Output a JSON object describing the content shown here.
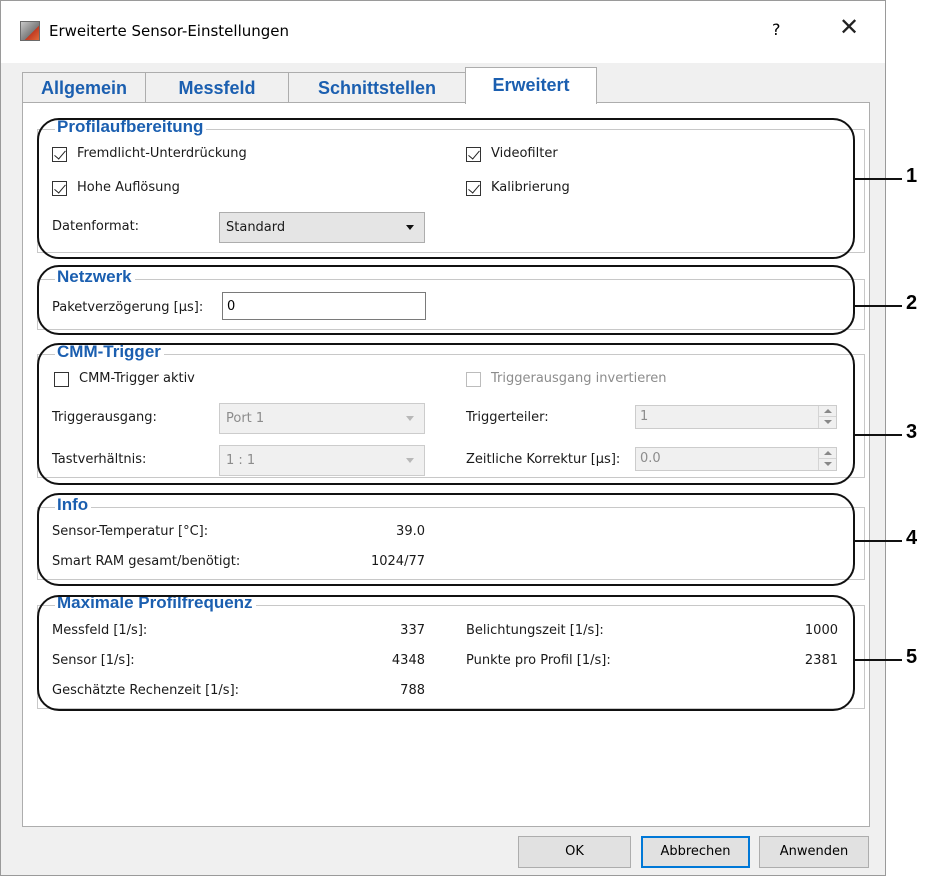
{
  "window": {
    "title": "Erweiterte Sensor-Einstellungen",
    "help_label": "?",
    "close_label": "✕"
  },
  "tabs": [
    {
      "label": "Allgemein",
      "active": false
    },
    {
      "label": "Messfeld",
      "active": false
    },
    {
      "label": "Schnittstellen",
      "active": false
    },
    {
      "label": "Erweitert",
      "active": true
    }
  ],
  "profilaufbereitung": {
    "title": "Profilaufbereitung",
    "fremdlicht": {
      "label": "Fremdlicht-Unterdrückung",
      "checked": true
    },
    "videofilter": {
      "label": "Videofilter",
      "checked": true
    },
    "hohe_aufloesung": {
      "label": "Hohe Auflösung",
      "checked": true
    },
    "kalibrierung": {
      "label": "Kalibrierung",
      "checked": true
    },
    "datenformat_label": "Datenformat:",
    "datenformat_value": "Standard"
  },
  "netzwerk": {
    "title": "Netzwerk",
    "paketverzoegerung_label": "Paketverzögerung [µs]:",
    "paketverzoegerung_value": "0"
  },
  "cmm_trigger": {
    "title": "CMM-Trigger",
    "aktiv": {
      "label": "CMM-Trigger aktiv",
      "checked": false
    },
    "invertieren": {
      "label": "Triggerausgang invertieren",
      "checked": false,
      "disabled": true
    },
    "triggerausgang_label": "Triggerausgang:",
    "triggerausgang_value": "Port 1",
    "triggerteiler_label": "Triggerteiler:",
    "triggerteiler_value": "1",
    "tastverhaeltnis_label": "Tastverhältnis:",
    "tastverhaeltnis_value": "1 : 1",
    "zeitliche_korrektur_label": "Zeitliche Korrektur [µs]:",
    "zeitliche_korrektur_value": "0.0"
  },
  "info": {
    "title": "Info",
    "sensor_temp_label": "Sensor-Temperatur [°C]:",
    "sensor_temp_value": "39.0",
    "smart_ram_label": "Smart RAM gesamt/benötigt:",
    "smart_ram_value": "1024/77"
  },
  "max_profilfrequenz": {
    "title": "Maximale Profilfrequenz",
    "messfeld_label": "Messfeld [1/s]:",
    "messfeld_value": "337",
    "belichtungszeit_label": "Belichtungszeit [1/s]:",
    "belichtungszeit_value": "1000",
    "sensor_label": "Sensor [1/s]:",
    "sensor_value": "4348",
    "punkte_label": "Punkte pro Profil [1/s]:",
    "punkte_value": "2381",
    "rechenzeit_label": "Geschätzte Rechenzeit  [1/s]:",
    "rechenzeit_value": "788"
  },
  "callouts": [
    "1",
    "2",
    "3",
    "4",
    "5"
  ],
  "buttons": {
    "ok": "OK",
    "abbrechen": "Abbrechen",
    "anwenden": "Anwenden"
  },
  "colors": {
    "accent": "#1b5fb0",
    "default_button_border": "#0078d7"
  }
}
